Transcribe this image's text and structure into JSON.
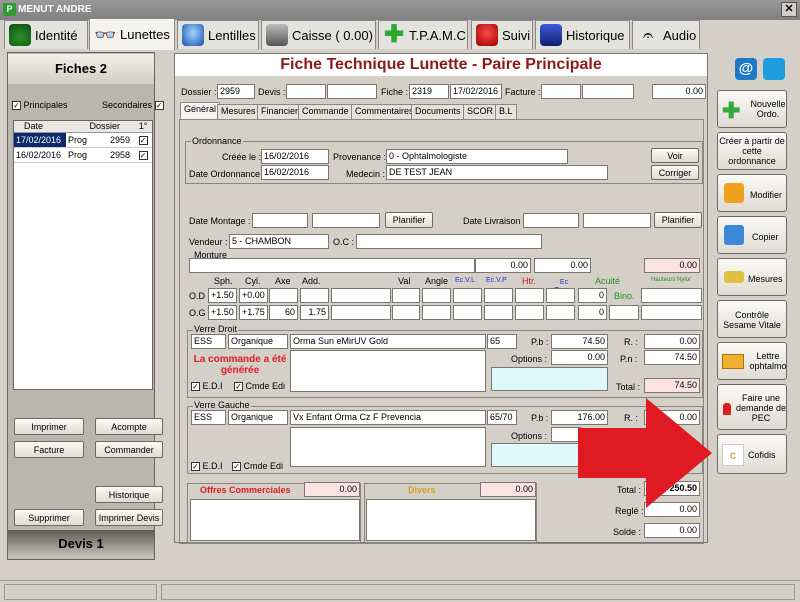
{
  "window": {
    "title": "MENUT ANDRE",
    "close": "✕"
  },
  "tabs": [
    {
      "label": "Identité"
    },
    {
      "label": "Lunettes"
    },
    {
      "label": "Lentilles"
    },
    {
      "label": "Caisse ( 0.00)"
    },
    {
      "label": "T.P.A.M.C"
    },
    {
      "label": "Suivi"
    },
    {
      "label": "Historique"
    },
    {
      "label": "Audio"
    }
  ],
  "left": {
    "header": "Fiches 2",
    "principales": "Principales",
    "secondaires": "Secondaires",
    "columns": [
      "Date",
      "Dossier",
      "1°"
    ],
    "rows": [
      {
        "date": "17/02/2016",
        "type": "Prog",
        "dossier": "2959",
        "check": "✓"
      },
      {
        "date": "16/02/2016",
        "type": "Prog",
        "dossier": "2958",
        "check": "✓"
      }
    ],
    "buttons": {
      "imprimer": "Imprimer",
      "acompte": "Acompte",
      "facture": "Facture",
      "commander": "Commander",
      "historique": "Historique",
      "supprimer": "Supprimer",
      "imprimer_devis": "Imprimer Devis"
    },
    "footer": "Devis 1"
  },
  "main": {
    "title": "Fiche Technique Lunette - Paire Principale",
    "dossier_label": "Dossier :",
    "dossier": "2959",
    "devis_label": "Devis :",
    "fiche_label": "Fiche :",
    "fiche": "2319",
    "fiche_date": "17/02/2016",
    "facture_label": "Facture :",
    "facture_total": "0.00",
    "subtabs": [
      "Général",
      "Mesures",
      "Financier",
      "Commande",
      "Commentaires",
      "Documents",
      "SCOR",
      "B.L"
    ],
    "ordonnance": {
      "title": "Ordonnance",
      "creee_label": "Créée le :",
      "creee": "16/02/2016",
      "date_ordo_label": "Date Ordonnance :",
      "date_ordo": "16/02/2016",
      "provenance_label": "Provenance :",
      "provenance": "0 - Ophtalmologiste",
      "medecin_label": "Medecin :",
      "medecin": "DE TEST JEAN",
      "voir": "Voir",
      "corriger": "Corriger"
    },
    "montage_label": "Date Montage :",
    "planifier": "Planifier",
    "livraison_label": "Date Livraison :",
    "vendeur_label": "Vendeur :",
    "vendeur": "5 - CHAMBON",
    "oc_label": "O.C :",
    "monture": {
      "title": "Monture",
      "v1": "0.00",
      "v2": "0.00",
      "v3": "0.00"
    },
    "rx": {
      "headers": [
        "Sph.",
        "Cyl.",
        "Axe",
        "Add.",
        "Val",
        "Angle",
        "Ec.V.L",
        "Ec.V.P",
        "Htr.",
        "Ec Temp.",
        "Acuité",
        "Hauteurs Nylor"
      ],
      "bino": "Bino.",
      "od_label": "O.D",
      "og_label": "O.G",
      "od": {
        "sph": "+1.50",
        "cyl": "+0.00",
        "axe": "",
        "add": "",
        "acuite": "0"
      },
      "og": {
        "sph": "+1.50",
        "cyl": "+1.75",
        "axe": "60",
        "add": "1.75",
        "acuite": "0"
      }
    },
    "verre_droit": {
      "title": "Verre Droit",
      "brand": "ESS",
      "material": "Organique",
      "name": "Orma Sun eMirUV Gold",
      "diam": "65",
      "pb_label": "P.b :",
      "pb": "74.50",
      "options_label": "Options :",
      "options": "0.00",
      "r_label": "R. :",
      "r": "0.00",
      "pn_label": "P.n :",
      "pn": "74.50",
      "total_label": "Total :",
      "total": "74.50",
      "alert": "La commande a été générée",
      "edi": "E.D.I",
      "cmde_edi": "Cmde Edi"
    },
    "verre_gauche": {
      "title": "Verre Gauche",
      "brand": "ESS",
      "material": "Organique",
      "name": "Vx Enfant Orma Cz F Prevencia",
      "diam": "65/70",
      "pb_label": "P.b :",
      "pb": "176.00",
      "options_label": "Options :",
      "r_label": "R. :",
      "r": "0.00",
      "edi": "E.D.I",
      "cmde_edi": "Cmde Edi"
    },
    "offres_label": "Offres Commerciales",
    "offres": "0.00",
    "divers_label": "Divers",
    "divers": "0.00",
    "total_label": "Total :",
    "total": "250.50",
    "regle_label": "Reglé :",
    "regle": "0.00",
    "solde_label": "Solde :",
    "solde": "0.00"
  },
  "right": {
    "at": "@",
    "buttons": [
      "Nouvelle Ordo.",
      "Créer à partir de cette ordonnance",
      "Modifier",
      "Copier",
      "Mesures",
      "Contrôle Sesame Vitale",
      "Lettre ophtalmo",
      "Faire une demande de PEC",
      "Cofidis"
    ]
  },
  "colors": {
    "accent_red": "#e01a22",
    "title_red": "#8b1a1a",
    "selection": "#0a2a6b"
  }
}
